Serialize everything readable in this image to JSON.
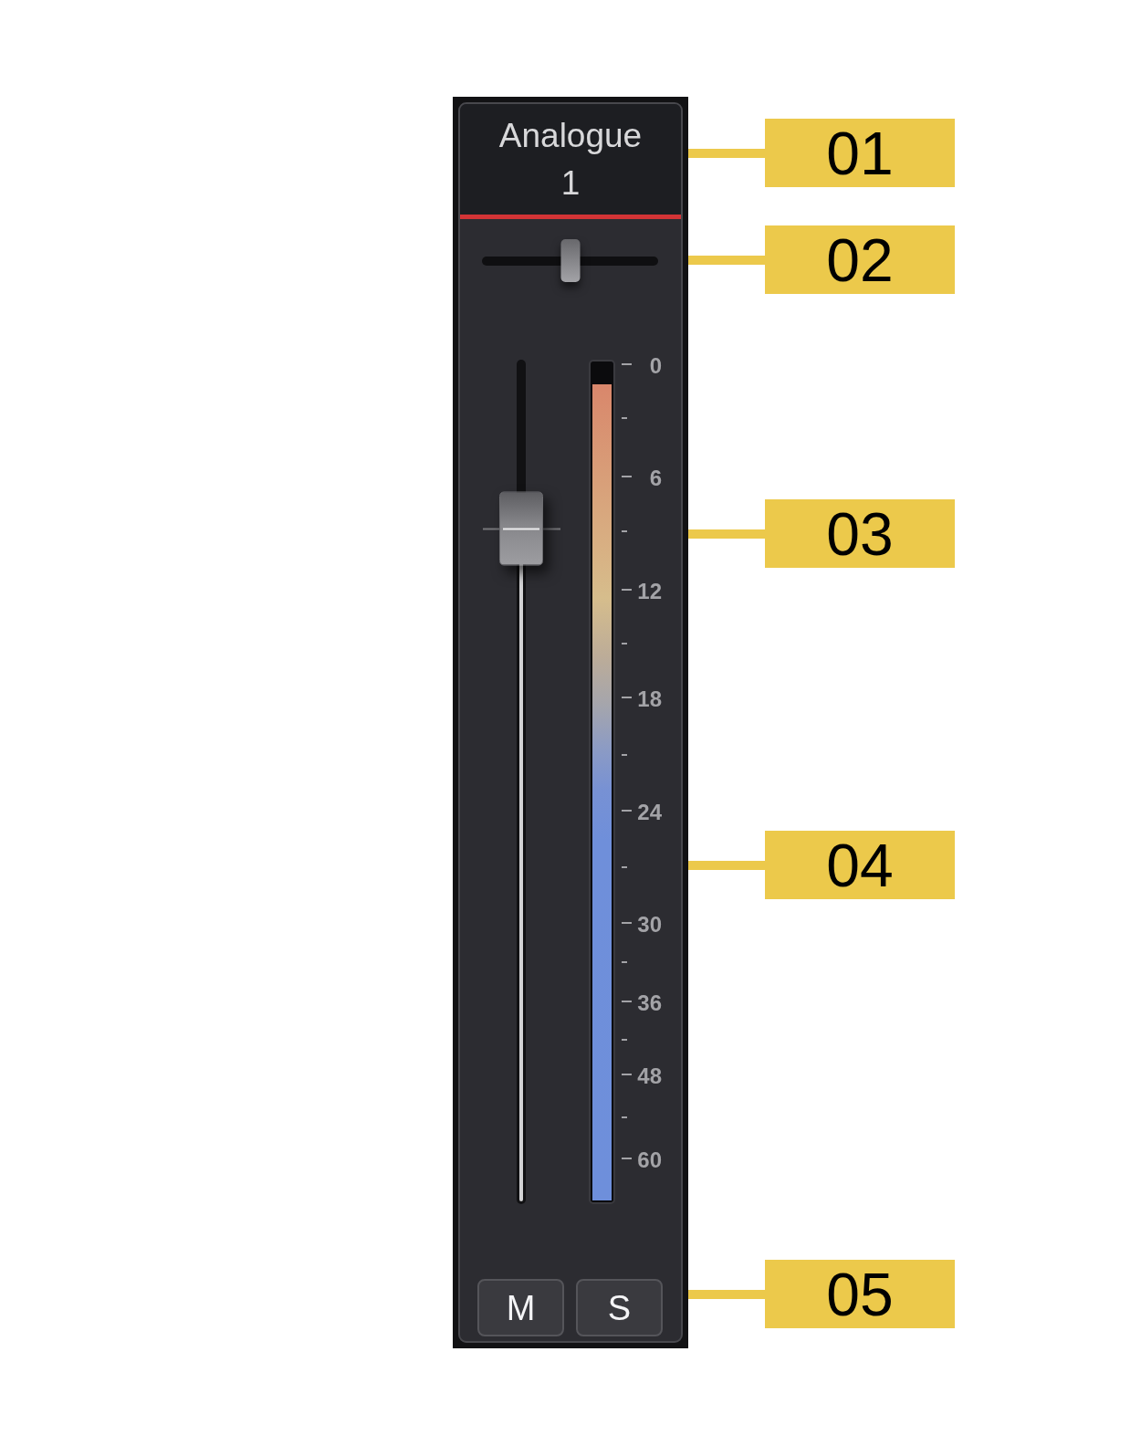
{
  "channel": {
    "name": "Analogue 1",
    "pan": {
      "level": 0.5
    },
    "fader": {
      "level": 0.8
    },
    "meter": {
      "level": 0.975,
      "scale": [
        "0",
        "6",
        "12",
        "18",
        "24",
        "30",
        "36",
        "48",
        "60"
      ]
    },
    "buttons": [
      {
        "label": "M",
        "on": false
      },
      {
        "label": "S",
        "on": false
      }
    ]
  },
  "callouts": [
    {
      "label": "01"
    },
    {
      "label": "02"
    },
    {
      "label": "03"
    },
    {
      "label": "04"
    },
    {
      "label": "05"
    }
  ]
}
